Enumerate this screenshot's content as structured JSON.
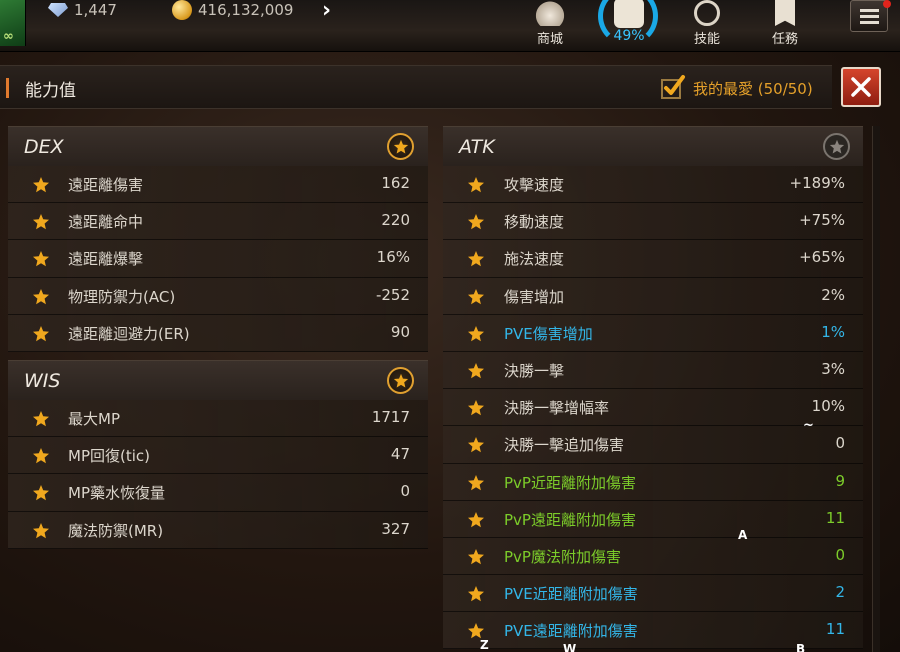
{
  "hud": {
    "gems": "1,447",
    "gold": "416,132,009",
    "avatar_symbol": "∞",
    "expand_icon": "chevron-right-icon",
    "buttons": [
      {
        "label": "商城",
        "icon": "shop-icon"
      },
      {
        "label": "49%",
        "icon": "bag-icon",
        "progress": 0.49
      },
      {
        "label": "技能",
        "icon": "skill-icon"
      },
      {
        "label": "任務",
        "icon": "quest-icon"
      }
    ],
    "menu_icon": "hamburger-icon",
    "accent": "#1aa8e6"
  },
  "panel": {
    "title": "能力值",
    "favorites_label": "我的最愛 (50/50)",
    "close_icon": "close-icon"
  },
  "sections": {
    "dex": {
      "title": "DEX",
      "favorited": true,
      "rows": [
        {
          "name": "遠距離傷害",
          "value": "162",
          "color": "normal"
        },
        {
          "name": "遠距離命中",
          "value": "220",
          "color": "normal"
        },
        {
          "name": "遠距離爆擊",
          "value": "16%",
          "color": "normal"
        },
        {
          "name": "物理防禦力(AC)",
          "value": "-252",
          "color": "normal"
        },
        {
          "name": "遠距離迴避力(ER)",
          "value": "90",
          "color": "normal"
        }
      ]
    },
    "wis": {
      "title": "WIS",
      "favorited": true,
      "rows": [
        {
          "name": "最大MP",
          "value": "1717",
          "color": "normal"
        },
        {
          "name": "MP回復(tic)",
          "value": "47",
          "color": "normal"
        },
        {
          "name": "MP藥水恢復量",
          "value": "0",
          "color": "normal"
        },
        {
          "name": "魔法防禦(MR)",
          "value": "327",
          "color": "normal"
        }
      ]
    },
    "atk": {
      "title": "ATK",
      "favorited": false,
      "rows": [
        {
          "name": "攻擊速度",
          "value": "+189%",
          "color": "normal"
        },
        {
          "name": "移動速度",
          "value": "+75%",
          "color": "normal"
        },
        {
          "name": "施法速度",
          "value": "+65%",
          "color": "normal"
        },
        {
          "name": "傷害增加",
          "value": "2%",
          "color": "normal"
        },
        {
          "name": "PVE傷害增加",
          "value": "1%",
          "color": "blue"
        },
        {
          "name": "決勝一擊",
          "value": "3%",
          "color": "normal"
        },
        {
          "name": "決勝一擊增幅率",
          "value": "10%",
          "color": "normal"
        },
        {
          "name": "決勝一擊追加傷害",
          "value": "0",
          "color": "normal"
        },
        {
          "name": "PvP近距離附加傷害",
          "value": "9",
          "color": "green"
        },
        {
          "name": "PvP遠距離附加傷害",
          "value": "11",
          "color": "green"
        },
        {
          "name": "PvP魔法附加傷害",
          "value": "0",
          "color": "green"
        },
        {
          "name": "PVE近距離附加傷害",
          "value": "2",
          "color": "blue"
        },
        {
          "name": "PVE遠距離附加傷害",
          "value": "11",
          "color": "blue"
        }
      ]
    }
  },
  "keys": {
    "a": "A",
    "tilde": "~",
    "z": "Z",
    "w": "W",
    "b": "B"
  },
  "colors": {
    "star": "#f0a81e",
    "blue_stat": "#33b6e8",
    "green_stat": "#7ccc2a",
    "favorite_label": "#e4a02a"
  }
}
